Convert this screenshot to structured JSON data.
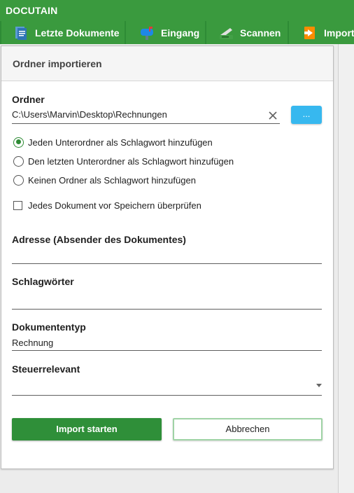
{
  "app": {
    "title": "DOCUTAIN"
  },
  "tabs": [
    {
      "label": "Letzte Dokumente",
      "icon": "recent-documents-icon"
    },
    {
      "label": "Eingang",
      "icon": "mailbox-icon"
    },
    {
      "label": "Scannen",
      "icon": "scanner-icon"
    },
    {
      "label": "Importi",
      "icon": "import-icon"
    }
  ],
  "panel": {
    "title": "Ordner importieren",
    "folder": {
      "label": "Ordner",
      "value": "C:\\Users\\Marvin\\Desktop\\Rechnungen",
      "browse_label": "..."
    },
    "options": [
      {
        "label": "Jeden Unterordner als Schlagwort hinzufügen",
        "checked": true
      },
      {
        "label": "Den letzten Unterordner als Schlagwort hinzufügen",
        "checked": false
      },
      {
        "label": "Keinen Ordner als Schlagwort hinzufügen",
        "checked": false
      }
    ],
    "check_before_save": {
      "label": "Jedes Dokument vor Speichern überprüfen",
      "checked": false
    },
    "address": {
      "label": "Adresse (Absender des Dokumentes)",
      "value": ""
    },
    "keywords": {
      "label": "Schlagwörter",
      "value": ""
    },
    "doctype": {
      "label": "Dokumententyp",
      "value": "Rechnung"
    },
    "tax": {
      "label": "Steuerrelevant",
      "value": ""
    },
    "buttons": {
      "start": "Import starten",
      "cancel": "Abbrechen"
    }
  },
  "colors": {
    "titlebar": "#3a9a3e",
    "accent": "#2e8b35",
    "browse": "#37b8ef"
  }
}
